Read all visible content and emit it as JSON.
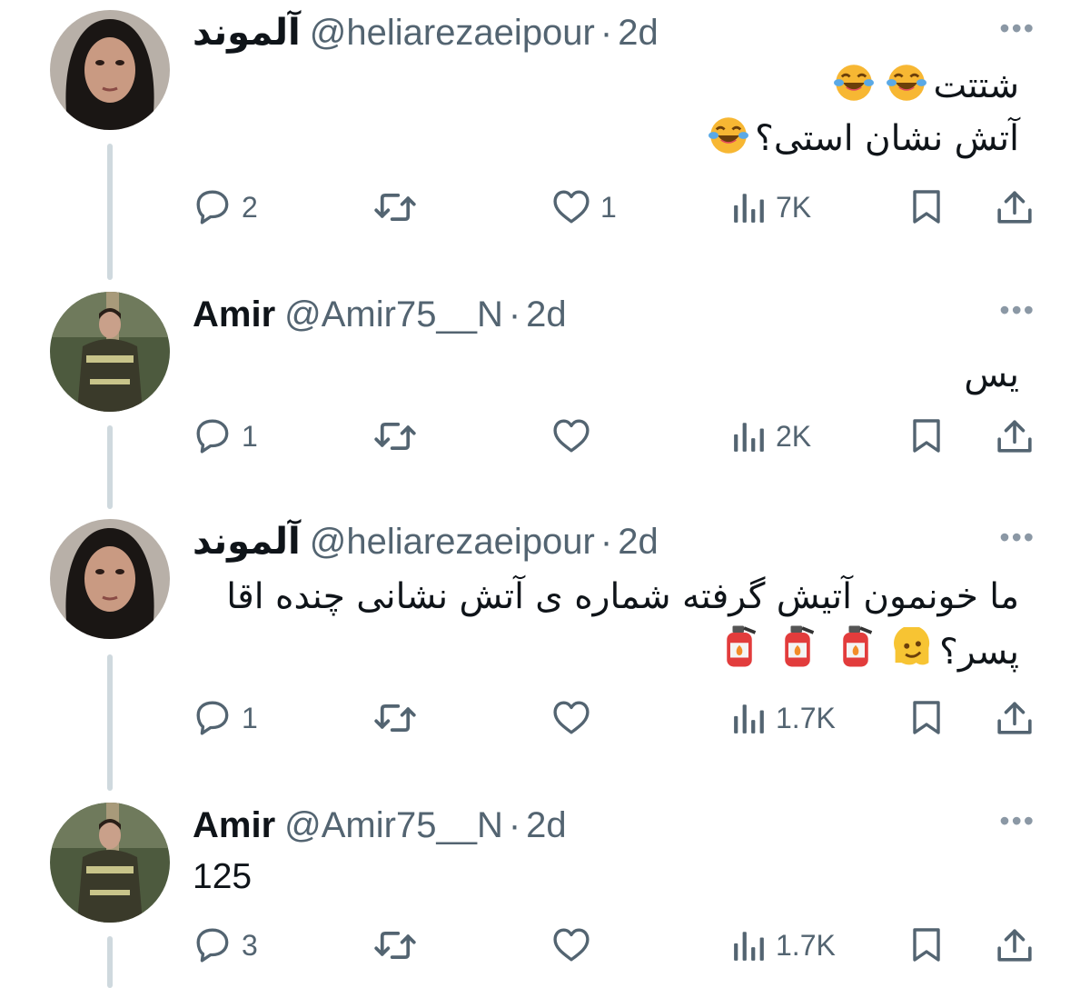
{
  "colors": {
    "text": "#0f1419",
    "muted": "#536471",
    "thread": "#cfd9de"
  },
  "tweets": [
    {
      "name": "آلموند",
      "handle": "@heliarezaeipour",
      "time": "2d",
      "lines": [
        "شتتت",
        "آتش نشان استی؟"
      ],
      "emojis": [
        "face-with-tears-of-joy",
        "face-with-tears-of-joy",
        "face-with-tears-of-joy"
      ],
      "replies": "2",
      "retweets": "",
      "likes": "1",
      "views": "7K"
    },
    {
      "name": "Amir",
      "handle": "@Amir75__N",
      "time": "2d",
      "lines": [
        "یس"
      ],
      "replies": "1",
      "retweets": "",
      "likes": "",
      "views": "2K"
    },
    {
      "name": "آلموند",
      "handle": "@heliarezaeipour",
      "time": "2d",
      "lines": [
        "ما خونمون آتیش گرفته شماره ی آتش نشانی چنده اقا",
        "پسر؟"
      ],
      "emojis": [
        "melting-face",
        "fire-extinguisher",
        "fire-extinguisher",
        "fire-extinguisher"
      ],
      "replies": "1",
      "retweets": "",
      "likes": "",
      "views": "1.7K"
    },
    {
      "name": "Amir",
      "handle": "@Amir75__N",
      "time": "2d",
      "lines": [
        "125"
      ],
      "replies": "3",
      "retweets": "",
      "likes": "",
      "views": "1.7K"
    }
  ],
  "icons": [
    "more-icon",
    "reply-icon",
    "retweet-icon",
    "like-icon",
    "views-icon",
    "bookmark-icon",
    "share-icon"
  ],
  "more_label": "•••",
  "separator": "·"
}
